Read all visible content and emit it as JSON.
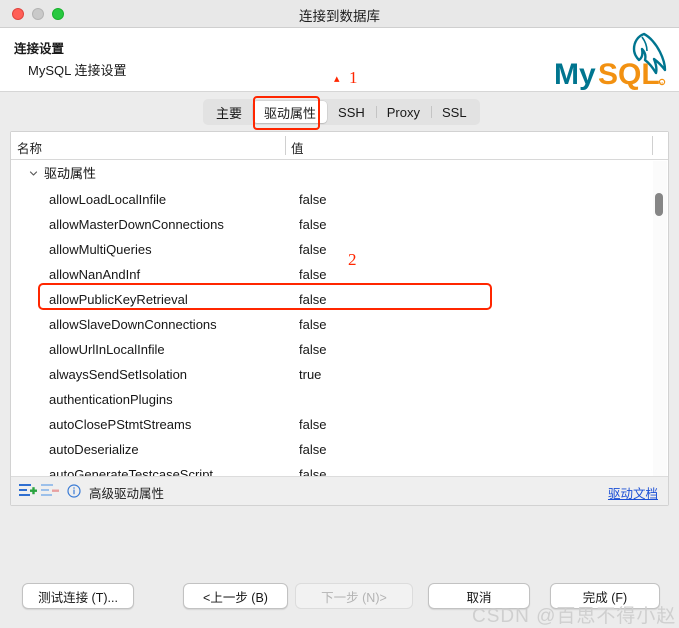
{
  "window": {
    "title": "连接到数据库",
    "traffic_lights": [
      "close",
      "minimize",
      "zoom"
    ]
  },
  "header": {
    "title": "连接设置",
    "subtitle": "MySQL 连接设置",
    "logo": "mysql-logo"
  },
  "tabs": [
    {
      "label": "主要",
      "selected": false
    },
    {
      "label": "驱动属性",
      "selected": true
    },
    {
      "label": "SSH",
      "selected": false
    },
    {
      "label": "Proxy",
      "selected": false
    },
    {
      "label": "SSL",
      "selected": false
    }
  ],
  "table": {
    "columns": [
      "名称",
      "值"
    ],
    "group": {
      "label": "驱动属性",
      "expanded": true
    },
    "rows": [
      {
        "name": "allowLoadLocalInfile",
        "value": "false",
        "highlighted": false
      },
      {
        "name": "allowMasterDownConnections",
        "value": "false",
        "highlighted": false
      },
      {
        "name": "allowMultiQueries",
        "value": "false",
        "highlighted": false
      },
      {
        "name": "allowNanAndInf",
        "value": "false",
        "highlighted": false
      },
      {
        "name": "allowPublicKeyRetrieval",
        "value": "false",
        "highlighted": true
      },
      {
        "name": "allowSlaveDownConnections",
        "value": "false",
        "highlighted": false
      },
      {
        "name": "allowUrlInLocalInfile",
        "value": "false",
        "highlighted": false
      },
      {
        "name": "alwaysSendSetIsolation",
        "value": "true",
        "highlighted": false
      },
      {
        "name": "authenticationPlugins",
        "value": "",
        "highlighted": false
      },
      {
        "name": "autoClosePStmtStreams",
        "value": "false",
        "highlighted": false
      },
      {
        "name": "autoDeserialize",
        "value": "false",
        "highlighted": false
      },
      {
        "name": "autoGenerateTestcaseScript",
        "value": "false",
        "highlighted": false
      }
    ]
  },
  "panel_footer": {
    "add_icon": "add-property-icon",
    "remove_icon": "remove-property-icon",
    "info_icon": "info-icon",
    "label": "高级驱动属性",
    "link": "驱动文档"
  },
  "footer_buttons": [
    {
      "label": "测试连接 (T)...",
      "disabled": false
    },
    {
      "label": "<上一步 (B)",
      "disabled": false
    },
    {
      "label": "下一步 (N)>",
      "disabled": true
    },
    {
      "label": "取消",
      "disabled": false
    },
    {
      "label": "完成 (F)",
      "disabled": false
    }
  ],
  "annotations": [
    {
      "id": "1",
      "label": "1",
      "target": "驱动属性 tab"
    },
    {
      "id": "2",
      "label": "2",
      "target": "allowPublicKeyRetrieval row"
    }
  ],
  "watermark": "CSDN @百思不得小赵",
  "colors": {
    "annotation_red": "#ff2600",
    "link_blue": "#1a4fd6",
    "mysql_teal": "#00758f",
    "mysql_orange": "#f29111",
    "traffic_red": "#ff5f57",
    "traffic_gray": "#c9c9c9",
    "traffic_green": "#28c840"
  }
}
